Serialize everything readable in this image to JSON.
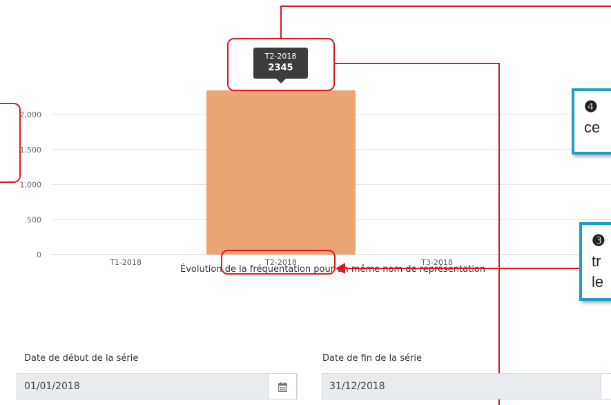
{
  "chart_data": {
    "type": "bar",
    "categories": [
      "T1-2018",
      "T2-2018",
      "T3-2018"
    ],
    "values": [
      0,
      2345,
      0
    ],
    "y_ticks": [
      "0",
      "500",
      "1,000",
      "1,500",
      "2,000"
    ],
    "ylim": [
      0,
      2400
    ],
    "xlabel": "Évolution de la fréquentation pour un même nom de représentation",
    "bar_color": "#e9a672",
    "grid": true
  },
  "tooltip": {
    "category": "T2-2018",
    "value": "2345"
  },
  "callouts": [
    {
      "number": "❹",
      "text": "ce"
    },
    {
      "number": "❸",
      "lines": [
        "tr",
        "le"
      ]
    }
  ],
  "form": {
    "start_label": "Date de début de la série",
    "start_value": "01/01/2018",
    "end_label": "Date de fin de la série",
    "end_value": "31/12/2018"
  },
  "colors": {
    "highlight": "#e0141c",
    "callout_border": "#1a9ec8",
    "tooltip_bg": "#3c3c3c"
  }
}
